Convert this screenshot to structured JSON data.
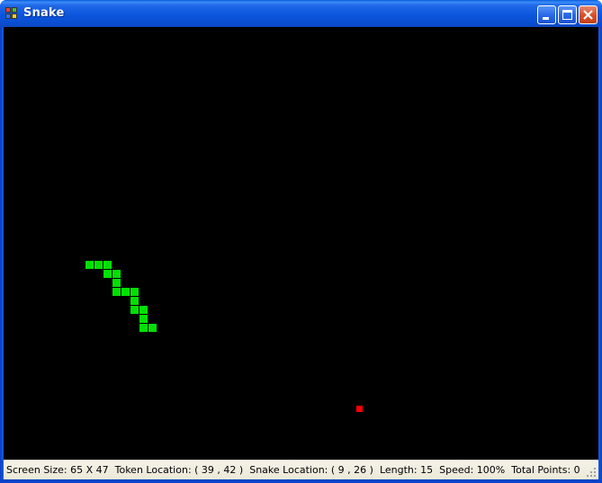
{
  "window": {
    "title": "Snake",
    "buttons": {
      "minimize": "minimize-icon",
      "maximize": "maximize-icon",
      "close": "close-icon"
    }
  },
  "game": {
    "background": "#000000",
    "snake_color": "#00e000",
    "token_color": "#ff0000",
    "grid": {
      "cols": 65,
      "rows": 47
    },
    "snake_cells": [
      [
        9,
        26
      ],
      [
        10,
        26
      ],
      [
        11,
        26
      ],
      [
        11,
        27
      ],
      [
        12,
        27
      ],
      [
        12,
        28
      ],
      [
        12,
        29
      ],
      [
        13,
        29
      ],
      [
        14,
        29
      ],
      [
        14,
        30
      ],
      [
        14,
        31
      ],
      [
        15,
        31
      ],
      [
        15,
        32
      ],
      [
        15,
        33
      ],
      [
        16,
        33
      ]
    ],
    "token_cell": [
      39,
      42
    ]
  },
  "status": {
    "screen_size": "Screen Size: 65 X 47",
    "token_location": "Token Location: ( 39 , 42 )",
    "snake_location": "Snake Location: ( 9 , 26 )",
    "length": "Length: 15",
    "speed": "Speed: 100%",
    "total_points": "Total Points: 0"
  }
}
